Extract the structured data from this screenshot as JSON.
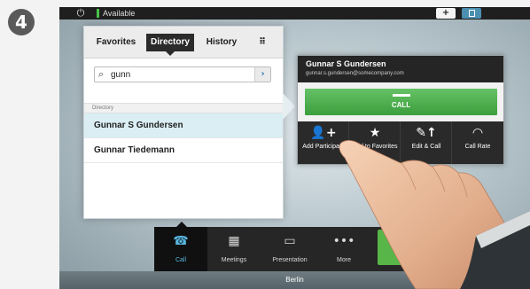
{
  "step": {
    "number": "4"
  },
  "status_bar": {
    "power_icon": "power-icon",
    "presence_text": "Available",
    "presence_color": "#4ac24a",
    "selfview_icon": "selfview-icon",
    "layout_icon": "layout-icon"
  },
  "directory": {
    "tabs": [
      {
        "label": "Favorites"
      },
      {
        "label": "Directory"
      },
      {
        "label": "History"
      },
      {
        "label": "⠿"
      }
    ],
    "search": {
      "value": "gunn",
      "go_label": "›"
    },
    "list_header": "Directory",
    "items": [
      {
        "label": "Gunnar S Gundersen"
      },
      {
        "label": "Gunnar Tiedemann"
      }
    ]
  },
  "contact_card": {
    "name": "Gunnar S Gundersen",
    "email": "gunnar.s.gundersen@somecompany.com",
    "call_label": "CALL",
    "call_color": "#4cab4c",
    "actions": [
      {
        "icon": "add-participant-icon",
        "glyph": "👤+",
        "label": "Add Participant"
      },
      {
        "icon": "star-icon",
        "glyph": "★",
        "label": "Add to Favorites"
      },
      {
        "icon": "edit-call-icon",
        "glyph": "✎↑",
        "label": "Edit & Call"
      },
      {
        "icon": "call-rate-icon",
        "glyph": "◠",
        "label": "Call Rate"
      }
    ]
  },
  "dock": {
    "items": [
      {
        "icon": "call-icon",
        "glyph": "☎",
        "label": "Call"
      },
      {
        "icon": "meetings-icon",
        "glyph": "▦",
        "label": "Meetings"
      },
      {
        "icon": "presentation-icon",
        "glyph": "▭",
        "label": "Presentation"
      },
      {
        "icon": "more-icon",
        "glyph": "•••",
        "label": "More"
      }
    ]
  },
  "location": "Berlin",
  "accent": "#58b7e0"
}
